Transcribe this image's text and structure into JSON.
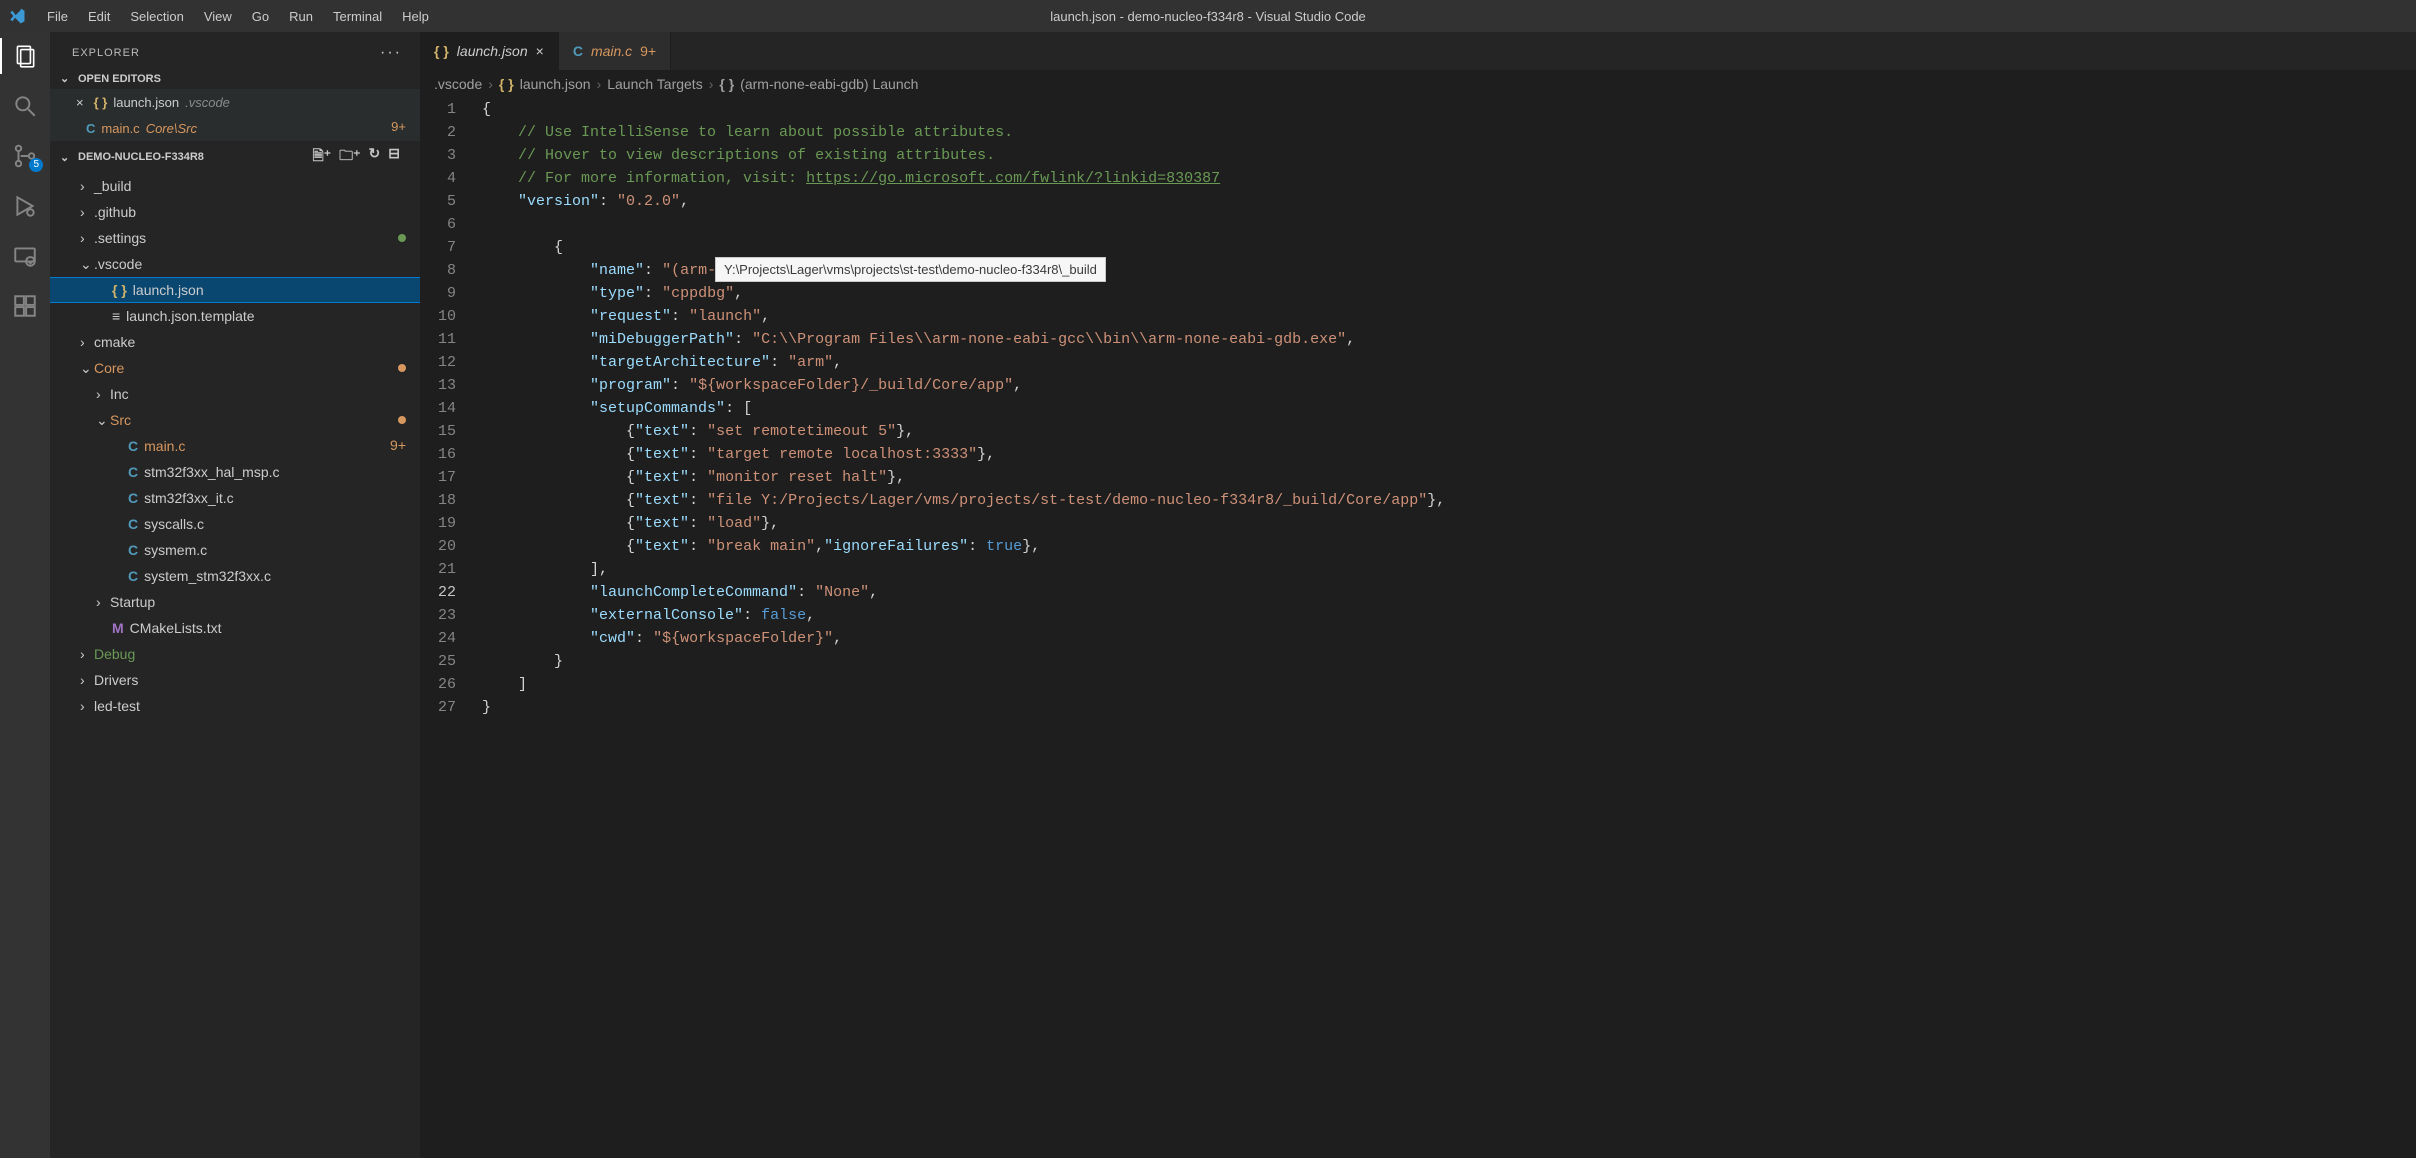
{
  "window_title": "launch.json - demo-nucleo-f334r8 - Visual Studio Code",
  "menu": [
    "File",
    "Edit",
    "Selection",
    "View",
    "Go",
    "Run",
    "Terminal",
    "Help"
  ],
  "sidebar": {
    "title": "EXPLORER",
    "open_editors_label": "OPEN EDITORS",
    "open_editors": [
      {
        "icon": "{ }",
        "icon_class": "c-json",
        "label": "launch.json",
        "hint": ".vscode",
        "close": "×"
      },
      {
        "icon": "C",
        "icon_class": "c-blue",
        "label": "main.c",
        "hint": "Core\\Src",
        "badge": "9+",
        "label_color": "#d7975e",
        "hint_color": "#d7975e"
      }
    ],
    "folder_label": "DEMO-NUCLEO-F334R8",
    "tree": [
      {
        "indent": 1,
        "twisty": "›",
        "label": "_build",
        "type": "folder"
      },
      {
        "indent": 1,
        "twisty": "›",
        "label": ".github",
        "type": "folder"
      },
      {
        "indent": 1,
        "twisty": "›",
        "label": ".settings",
        "type": "folder",
        "mod": "#6a9955"
      },
      {
        "indent": 1,
        "twisty": "⌄",
        "label": ".vscode",
        "type": "folder"
      },
      {
        "indent": 2,
        "icon": "{ }",
        "icon_class": "c-json",
        "label": "launch.json",
        "selected": true
      },
      {
        "indent": 2,
        "icon": "≡",
        "icon_class": "",
        "label": "launch.json.template"
      },
      {
        "indent": 1,
        "twisty": "›",
        "label": "cmake",
        "type": "folder"
      },
      {
        "indent": 1,
        "twisty": "⌄",
        "label": "Core",
        "type": "folder",
        "label_color": "#d7975e",
        "mod": "#d7975e"
      },
      {
        "indent": 2,
        "twisty": "›",
        "label": "Inc",
        "type": "folder"
      },
      {
        "indent": 2,
        "twisty": "⌄",
        "label": "Src",
        "type": "folder",
        "label_color": "#d7975e",
        "mod": "#d7975e"
      },
      {
        "indent": 3,
        "icon": "C",
        "icon_class": "c-blue",
        "label": "main.c",
        "label_color": "#d7975e",
        "badge": "9+"
      },
      {
        "indent": 3,
        "icon": "C",
        "icon_class": "c-blue",
        "label": "stm32f3xx_hal_msp.c"
      },
      {
        "indent": 3,
        "icon": "C",
        "icon_class": "c-blue",
        "label": "stm32f3xx_it.c"
      },
      {
        "indent": 3,
        "icon": "C",
        "icon_class": "c-blue",
        "label": "syscalls.c"
      },
      {
        "indent": 3,
        "icon": "C",
        "icon_class": "c-blue",
        "label": "sysmem.c"
      },
      {
        "indent": 3,
        "icon": "C",
        "icon_class": "c-blue",
        "label": "system_stm32f3xx.c"
      },
      {
        "indent": 2,
        "twisty": "›",
        "label": "Startup",
        "type": "folder"
      },
      {
        "indent": 2,
        "icon": "M",
        "icon_class": "c-purple",
        "label": "CMakeLists.txt"
      },
      {
        "indent": 1,
        "twisty": "›",
        "label": "Debug",
        "type": "folder",
        "label_color": "#6a9955"
      },
      {
        "indent": 1,
        "twisty": "›",
        "label": "Drivers",
        "type": "folder"
      },
      {
        "indent": 1,
        "twisty": "›",
        "label": "led-test",
        "type": "folder"
      }
    ]
  },
  "tabs": [
    {
      "icon": "{ }",
      "icon_class": "c-json",
      "label": "launch.json",
      "active": true,
      "close": "×"
    },
    {
      "icon": "C",
      "icon_class": "c-blue",
      "label": "main.c",
      "label_color": "#d7975e",
      "badge": "9+"
    }
  ],
  "breadcrumbs": [
    {
      "text": ".vscode"
    },
    {
      "icon": "{ }",
      "icon_class": "c-json",
      "text": "launch.json"
    },
    {
      "text": "Launch Targets"
    },
    {
      "icon": "{ }",
      "icon_class": "",
      "text": "(arm-none-eabi-gdb) Launch"
    }
  ],
  "tooltip": "Y:\\Projects\\Lager\\vms\\projects\\st-test\\demo-nucleo-f334r8\\_build",
  "code": {
    "current_line": 22,
    "lines": [
      {
        "n": 1,
        "h": "<span class='s-pun'>{</span>"
      },
      {
        "n": 2,
        "h": "    <span class='s-com'>// Use IntelliSense to learn about possible attributes.</span>"
      },
      {
        "n": 3,
        "h": "    <span class='s-com'>// Hover to view descriptions of existing attributes.</span>"
      },
      {
        "n": 4,
        "h": "    <span class='s-com'>// For more information, visit: </span><span class='s-lnk'>https://go.microsoft.com/fwlink/?linkid=830387</span>"
      },
      {
        "n": 5,
        "h": "    <span class='s-key'>\"version\"</span><span class='s-pun'>: </span><span class='s-str'>\"0.2.0\"</span><span class='s-pun'>,</span>"
      },
      {
        "n": 6,
        "h": ""
      },
      {
        "n": 7,
        "h": "        <span class='s-pun'>{</span>"
      },
      {
        "n": 8,
        "h": "            <span class='s-key'>\"name\"</span><span class='s-pun'>: </span><span class='s-str'>\"(arm-none-eabi-gdb) Launch\"</span><span class='s-pun'>,</span>"
      },
      {
        "n": 9,
        "h": "            <span class='s-key'>\"type\"</span><span class='s-pun'>: </span><span class='s-str'>\"cppdbg\"</span><span class='s-pun'>,</span>"
      },
      {
        "n": 10,
        "h": "            <span class='s-key'>\"request\"</span><span class='s-pun'>: </span><span class='s-str'>\"launch\"</span><span class='s-pun'>,</span>"
      },
      {
        "n": 11,
        "h": "            <span class='s-key'>\"miDebuggerPath\"</span><span class='s-pun'>: </span><span class='s-str'>\"C:\\\\Program Files\\\\arm-none-eabi-gcc\\\\bin\\\\arm-none-eabi-gdb.exe\"</span><span class='s-pun'>,</span>"
      },
      {
        "n": 12,
        "h": "            <span class='s-key'>\"targetArchitecture\"</span><span class='s-pun'>: </span><span class='s-str'>\"arm\"</span><span class='s-pun'>,</span>"
      },
      {
        "n": 13,
        "h": "            <span class='s-key'>\"program\"</span><span class='s-pun'>: </span><span class='s-str'>\"${workspaceFolder}/_build/Core/app\"</span><span class='s-pun'>,</span>"
      },
      {
        "n": 14,
        "h": "            <span class='s-key'>\"setupCommands\"</span><span class='s-pun'>: [</span>"
      },
      {
        "n": 15,
        "h": "                <span class='s-pun'>{</span><span class='s-key'>\"text\"</span><span class='s-pun'>: </span><span class='s-str'>\"set remotetimeout 5\"</span><span class='s-pun'>},</span>"
      },
      {
        "n": 16,
        "h": "                <span class='s-pun'>{</span><span class='s-key'>\"text\"</span><span class='s-pun'>: </span><span class='s-str'>\"target remote localhost:3333\"</span><span class='s-pun'>},</span>"
      },
      {
        "n": 17,
        "h": "                <span class='s-pun'>{</span><span class='s-key'>\"text\"</span><span class='s-pun'>: </span><span class='s-str'>\"monitor reset halt\"</span><span class='s-pun'>},</span>"
      },
      {
        "n": 18,
        "h": "                <span class='s-pun'>{</span><span class='s-key'>\"text\"</span><span class='s-pun'>: </span><span class='s-str'>\"file Y:/Projects/Lager/vms/projects/st-test/demo-nucleo-f334r8/_build/Core/app\"</span><span class='s-pun'>},</span>"
      },
      {
        "n": 19,
        "h": "                <span class='s-pun'>{</span><span class='s-key'>\"text\"</span><span class='s-pun'>: </span><span class='s-str'>\"load\"</span><span class='s-pun'>},</span>"
      },
      {
        "n": 20,
        "h": "                <span class='s-pun'>{</span><span class='s-key'>\"text\"</span><span class='s-pun'>: </span><span class='s-str'>\"break main\"</span><span class='s-pun'>,</span><span class='s-key'>\"ignoreFailures\"</span><span class='s-pun'>: </span><span class='s-bool'>true</span><span class='s-pun'>},</span>"
      },
      {
        "n": 21,
        "h": "            <span class='s-pun'>],</span>"
      },
      {
        "n": 22,
        "h": "            <span class='s-key'>\"launchCompleteCommand\"</span><span class='s-pun'>: </span><span class='s-str'>\"None\"</span><span class='s-pun'>,</span>"
      },
      {
        "n": 23,
        "h": "            <span class='s-key'>\"externalConsole\"</span><span class='s-pun'>: </span><span class='s-bool'>false</span><span class='s-pun'>,</span>"
      },
      {
        "n": 24,
        "h": "            <span class='s-key'>\"cwd\"</span><span class='s-pun'>: </span><span class='s-str'>\"${workspaceFolder}\"</span><span class='s-pun'>,</span>"
      },
      {
        "n": 25,
        "h": "        <span class='s-pun'>}</span>"
      },
      {
        "n": 26,
        "h": "    <span class='s-pun'>]</span>"
      },
      {
        "n": 27,
        "h": "<span class='s-pun'>}</span>"
      }
    ]
  },
  "scm_badge": "5"
}
